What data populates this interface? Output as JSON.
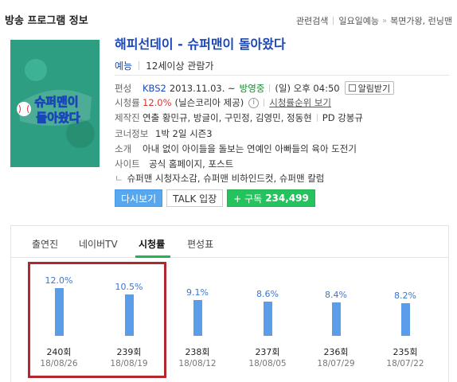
{
  "section": {
    "title": "방송 프로그램 정보"
  },
  "related": {
    "label": "관련검색",
    "genre": "일요일예능",
    "arrow": "»",
    "shows": "복면가왕, 런닝맨"
  },
  "poster": {
    "line1": "슈퍼맨이",
    "line2": "돌아왔다",
    "accent": "#2e9e83"
  },
  "program": {
    "title": "해피선데이 - 슈퍼맨이 돌아왔다",
    "genre": "예능",
    "rating": "12세이상 관람가"
  },
  "schedule": {
    "label": "편성",
    "channel": "KBS2",
    "start": "2013.11.03. ~",
    "status": "방영중",
    "time": "(일) 오후 04:50",
    "alarm": "알림받기"
  },
  "viewership": {
    "label": "시청률",
    "value": "12.0%",
    "source": "(닐슨코리아 제공)",
    "info_icon": "i",
    "rank_link": "시청률순위 보기"
  },
  "staff": {
    "label": "제작진",
    "text": "연출 황민규, 방글이, 구민정, 김영민, 정동현",
    "pd": "PD 강봉규"
  },
  "corner": {
    "label": "코너정보",
    "text": "1박 2일 시즌3"
  },
  "intro": {
    "label": "소개",
    "text": "아내 없이 아이들을 돌보는 연예인 아빠들의 육아 도전기"
  },
  "site": {
    "label": "사이트",
    "links": "공식 홈페이지, 포스트"
  },
  "subsites": {
    "prefix": "ㄴ",
    "links": "슈퍼맨 시청자소감, 슈퍼맨 비하인드컷, 슈퍼맨 칼럼"
  },
  "buttons": {
    "rewatch": "다시보기",
    "talk": "TALK 입장",
    "subscribe_prefix": "+ 구독",
    "subscribe_count": "234,499"
  },
  "tabs": [
    {
      "label": "출연진"
    },
    {
      "label": "네이버TV"
    },
    {
      "label": "시청률"
    },
    {
      "label": "편성표"
    }
  ],
  "active_tab": 2,
  "colors": {
    "link": "#1a47b8",
    "bar": "#5b9de8",
    "active_tab": "#1fb553",
    "highlight_box": "#b3262c"
  },
  "chart_data": {
    "type": "bar",
    "categories": [
      "240회",
      "239회",
      "238회",
      "237회",
      "236회",
      "235회"
    ],
    "dates": [
      "18/08/26",
      "18/08/19",
      "18/08/12",
      "18/08/05",
      "18/07/29",
      "18/07/22"
    ],
    "values": [
      12.0,
      10.5,
      9.1,
      8.6,
      8.4,
      8.2
    ],
    "value_labels": [
      "12.0%",
      "10.5%",
      "9.1%",
      "8.6%",
      "8.4%",
      "8.2%"
    ],
    "highlighted": [
      0,
      1
    ],
    "grid": false,
    "legend": "none"
  }
}
